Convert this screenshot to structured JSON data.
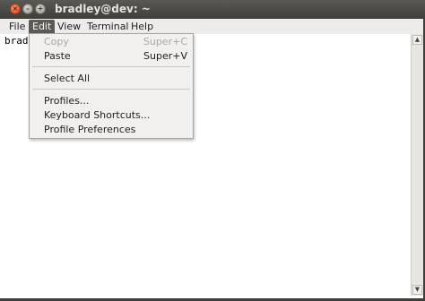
{
  "window": {
    "title": "bradley@dev: ~",
    "buttons": {
      "close": "×",
      "minimize": "–",
      "maximize": "+"
    }
  },
  "menubar": {
    "items": [
      {
        "label": "File"
      },
      {
        "label": "Edit"
      },
      {
        "label": "View"
      },
      {
        "label": "Terminal"
      },
      {
        "label": "Help"
      }
    ],
    "active": "Edit"
  },
  "terminal": {
    "text": "bradl"
  },
  "edit_menu": {
    "copy": {
      "label": "Copy",
      "shortcut": "Super+C",
      "enabled": false
    },
    "paste": {
      "label": "Paste",
      "shortcut": "Super+V",
      "enabled": true
    },
    "select_all": {
      "label": "Select All"
    },
    "profiles": {
      "label": "Profiles..."
    },
    "keyboard_shortcuts": {
      "label": "Keyboard Shortcuts..."
    },
    "profile_preferences": {
      "label": "Profile Preferences"
    }
  },
  "scrollbar": {
    "up_glyph": "▲",
    "down_glyph": "▼"
  }
}
